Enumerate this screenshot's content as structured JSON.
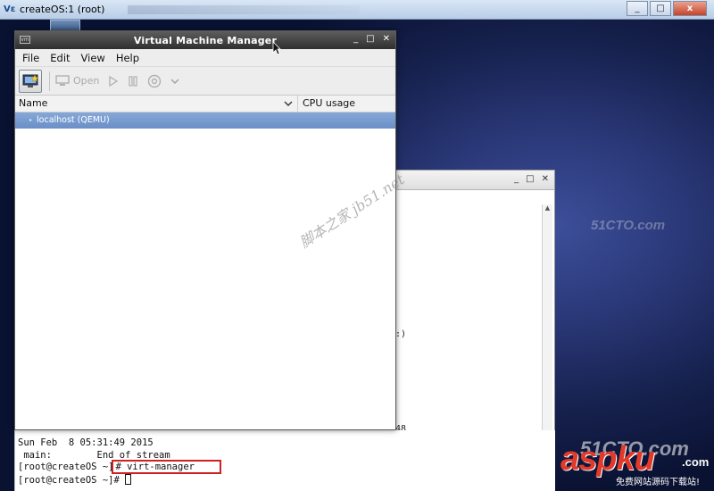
{
  "vnc": {
    "title": "createOS:1 (root)",
    "logo": "Vε",
    "minimize": "_",
    "maximize": "□",
    "close": "x"
  },
  "vmm": {
    "title": "Virtual Machine Manager",
    "menu": [
      "File",
      "Edit",
      "View",
      "Help"
    ],
    "toolbar": {
      "new_icon": "monitor-star-icon",
      "open_label": "Open",
      "run_icon": "play-icon",
      "pause_icon": "pause-icon",
      "shutdown_icon": "power-icon",
      "dropdown_icon": "chevron-down-icon"
    },
    "columns": {
      "name": "Name",
      "cpu": "CPU usage"
    },
    "rows": [
      "localhost (QEMU)"
    ]
  },
  "terminal": {
    "line1": "Sun Feb  8 05:31:49 2015",
    "line2": " main:        End of stream",
    "prompt1": "[root@createOS ~]",
    "command1": "# virt-manager",
    "prompt2": "[root@createOS ~]",
    "command2": "# "
  },
  "bg_window": {
    "frag1": ":)",
    "frag2": "48"
  },
  "watermarks": {
    "cn": "脚本之家 jb51.net",
    "top_51": "51CTO.com",
    "bottom_51": "51CTO.com",
    "aspku": "aspku",
    "aspku_com": ".com",
    "aspku_sub": "免费网站源码下载站!"
  }
}
